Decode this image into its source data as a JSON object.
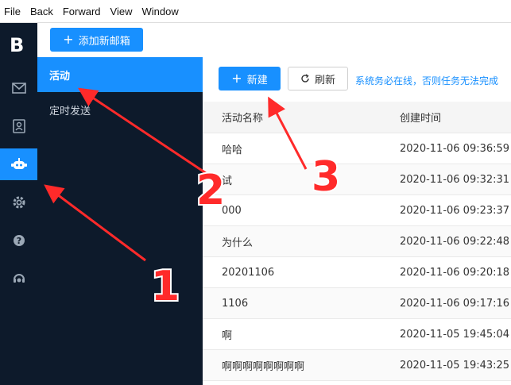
{
  "menu": [
    "File",
    "Back",
    "Forward",
    "View",
    "Window"
  ],
  "rail": {
    "logo": "B",
    "icons": [
      "mail-icon",
      "contacts-icon",
      "robot-icon",
      "gear-icon",
      "help-icon",
      "support-icon"
    ],
    "active_index": 2
  },
  "topbar": {
    "add_mailbox_label": "添加新邮箱"
  },
  "subnav": {
    "items": [
      "活动",
      "定时发送"
    ],
    "active_index": 0
  },
  "toolbar": {
    "new_label": "新建",
    "refresh_label": "刷新",
    "notice": "系统务必在线，否则任务无法完成"
  },
  "table": {
    "headers": [
      "活动名称",
      "创建时间"
    ],
    "rows": [
      [
        "哈哈",
        "2020-11-06 09:36:59"
      ],
      [
        "试",
        "2020-11-06 09:32:31"
      ],
      [
        "000",
        "2020-11-06 09:23:37"
      ],
      [
        "为什么",
        "2020-11-06 09:22:48"
      ],
      [
        "20201106",
        "2020-11-06 09:20:18"
      ],
      [
        "1106",
        "2020-11-06 09:17:16"
      ],
      [
        "啊",
        "2020-11-05 19:45:04"
      ],
      [
        "啊啊啊啊啊啊啊啊",
        "2020-11-05 19:43:25"
      ]
    ]
  },
  "annotations": {
    "labels": [
      "1",
      "2",
      "3"
    ],
    "color": "#ff2a2a"
  },
  "colors": {
    "accent": "#1890ff",
    "sidebar": "#0d1a2b"
  }
}
